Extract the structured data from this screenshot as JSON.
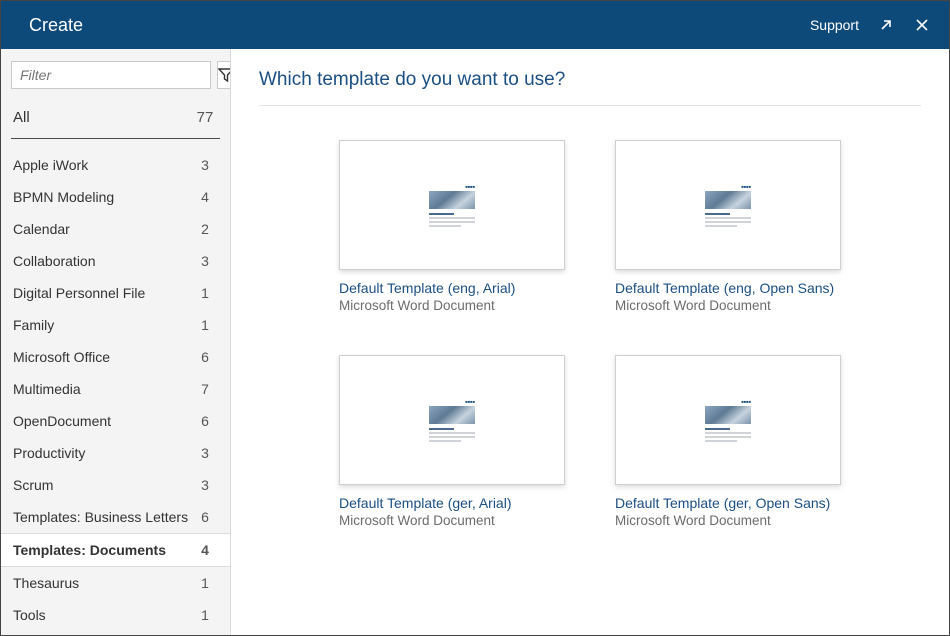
{
  "header": {
    "title": "Create",
    "support": "Support"
  },
  "sidebar": {
    "filter_placeholder": "Filter",
    "all_label": "All",
    "all_count": "77",
    "categories": [
      {
        "label": "Apple iWork",
        "count": "3"
      },
      {
        "label": "BPMN Modeling",
        "count": "4"
      },
      {
        "label": "Calendar",
        "count": "2"
      },
      {
        "label": "Collaboration",
        "count": "3"
      },
      {
        "label": "Digital Personnel File",
        "count": "1"
      },
      {
        "label": "Family",
        "count": "1"
      },
      {
        "label": "Microsoft Office",
        "count": "6"
      },
      {
        "label": "Multimedia",
        "count": "7"
      },
      {
        "label": "OpenDocument",
        "count": "6"
      },
      {
        "label": "Productivity",
        "count": "3"
      },
      {
        "label": "Scrum",
        "count": "3"
      },
      {
        "label": "Templates: Business Letters",
        "count": "6"
      },
      {
        "label": "Templates: Documents",
        "count": "4",
        "selected": true
      },
      {
        "label": "Thesaurus",
        "count": "1"
      },
      {
        "label": "Tools",
        "count": "1"
      }
    ]
  },
  "main": {
    "heading": "Which template do you want to use?",
    "templates": [
      {
        "title": "Default Template (eng, Arial)",
        "subtitle": "Microsoft Word Document"
      },
      {
        "title": "Default Template (eng, Open Sans)",
        "subtitle": "Microsoft Word Document"
      },
      {
        "title": "Default Template (ger, Arial)",
        "subtitle": "Microsoft Word Document"
      },
      {
        "title": "Default Template (ger, Open Sans)",
        "subtitle": "Microsoft Word Document"
      }
    ]
  }
}
